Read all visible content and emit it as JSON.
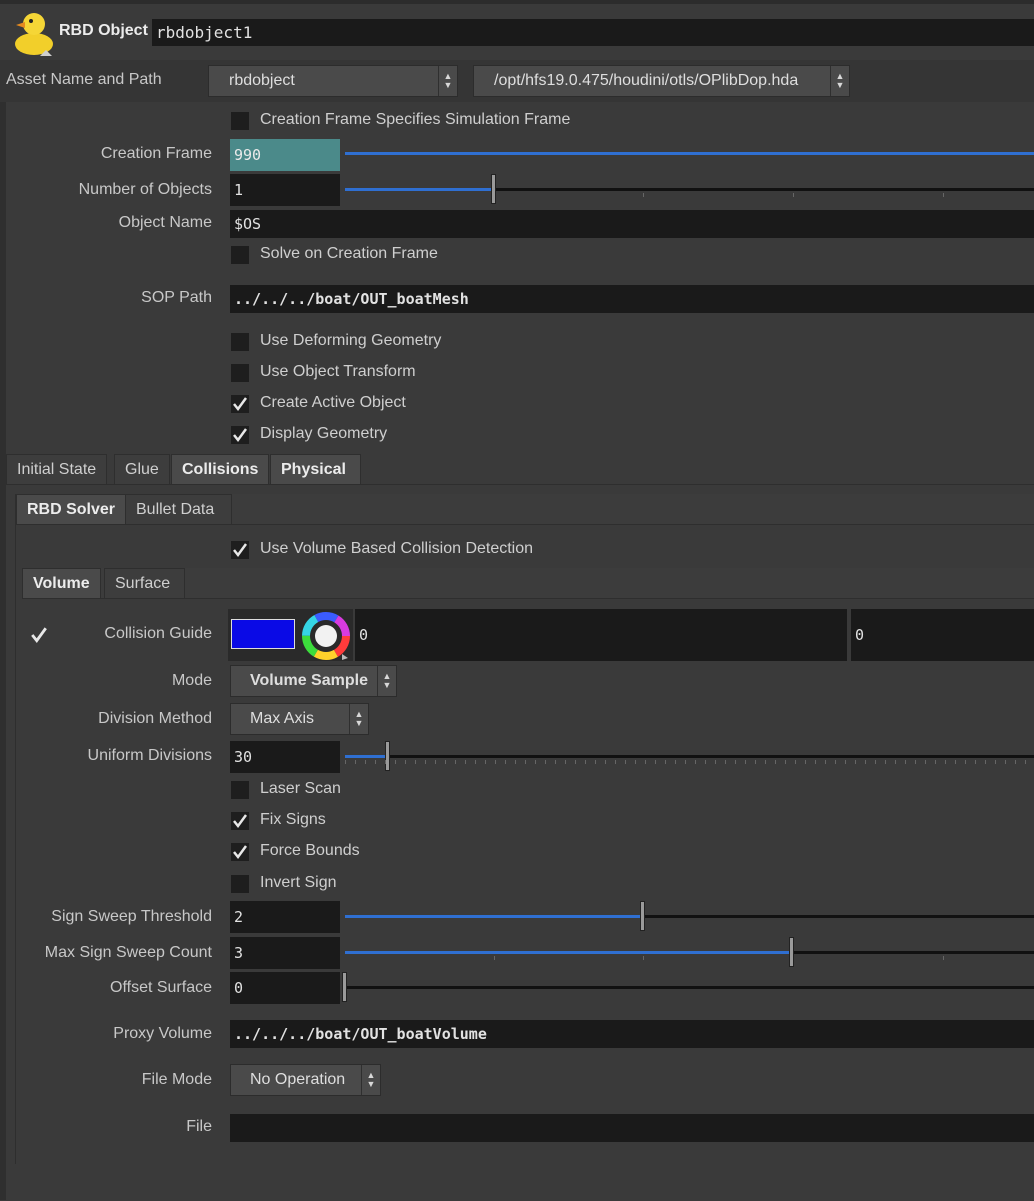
{
  "header": {
    "node_type": "RBD Object",
    "node_name": "rbdobject1",
    "icon": "rubber-duck-icon"
  },
  "asset": {
    "label": "Asset Name and Path",
    "name": "rbdobject",
    "path": "/opt/hfs19.0.475/houdini/otls/OPlibDop.hda"
  },
  "params": {
    "creation_frame_specifies": {
      "label": "Creation Frame Specifies Simulation Frame",
      "checked": false
    },
    "creation_frame": {
      "label": "Creation Frame",
      "value": "990"
    },
    "number_of_objects": {
      "label": "Number of Objects",
      "value": "1"
    },
    "object_name": {
      "label": "Object Name",
      "value": "$OS"
    },
    "solve_on_creation": {
      "label": "Solve on Creation Frame",
      "checked": false
    },
    "sop_path": {
      "label": "SOP Path",
      "value": "../../../boat/OUT_boatMesh"
    },
    "use_deforming": {
      "label": "Use Deforming Geometry",
      "checked": false
    },
    "use_object_transform": {
      "label": "Use Object Transform",
      "checked": false
    },
    "create_active": {
      "label": "Create Active Object",
      "checked": true
    },
    "display_geometry": {
      "label": "Display Geometry",
      "checked": true
    }
  },
  "tabs_main": [
    {
      "label": "Initial State",
      "active": false
    },
    {
      "label": "Glue",
      "active": false
    },
    {
      "label": "Collisions",
      "active": true
    },
    {
      "label": "Physical",
      "active": true
    }
  ],
  "tabs_solver": [
    {
      "label": "RBD Solver",
      "active": true
    },
    {
      "label": "Bullet Data",
      "active": false
    }
  ],
  "volume_based": {
    "label": "Use Volume Based Collision Detection",
    "checked": true
  },
  "tabs_collision": [
    {
      "label": "Volume",
      "active": true
    },
    {
      "label": "Surface",
      "active": false
    }
  ],
  "collision": {
    "guide": {
      "label": "Collision Guide",
      "checked": true,
      "color": "#0a0ae6",
      "v1": "0",
      "v2": "0"
    },
    "mode": {
      "label": "Mode",
      "value": "Volume Sample"
    },
    "division_method": {
      "label": "Division Method",
      "value": "Max Axis"
    },
    "uniform_divisions": {
      "label": "Uniform Divisions",
      "value": "30"
    },
    "laser_scan": {
      "label": "Laser Scan",
      "checked": false
    },
    "fix_signs": {
      "label": "Fix Signs",
      "checked": true
    },
    "force_bounds": {
      "label": "Force Bounds",
      "checked": true
    },
    "invert_sign": {
      "label": "Invert Sign",
      "checked": false
    },
    "sign_sweep_threshold": {
      "label": "Sign Sweep Threshold",
      "value": "2"
    },
    "max_sign_sweep_count": {
      "label": "Max Sign Sweep Count",
      "value": "3"
    },
    "offset_surface": {
      "label": "Offset Surface",
      "value": "0"
    },
    "proxy_volume": {
      "label": "Proxy Volume",
      "value": "../../../boat/OUT_boatVolume"
    },
    "file_mode": {
      "label": "File Mode",
      "value": "No Operation"
    },
    "file": {
      "label": "File",
      "value": ""
    }
  },
  "colors": {
    "accent": "#2f6fd1",
    "highlight_field": "#4b8a8a"
  }
}
